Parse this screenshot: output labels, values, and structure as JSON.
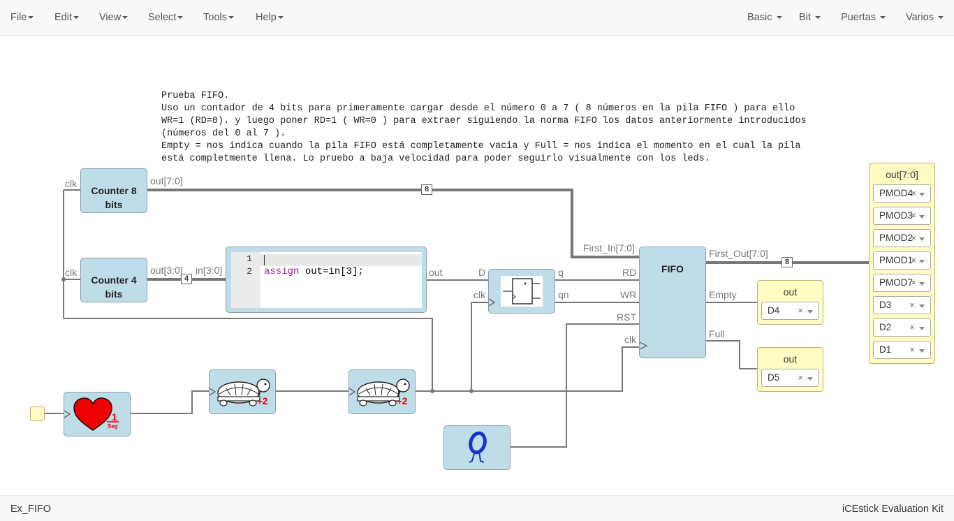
{
  "menu": {
    "file": "File",
    "edit": "Edit",
    "view": "View",
    "select": "Select",
    "tools": "Tools",
    "help": "Help",
    "basic": "Basic",
    "bit": "Bit",
    "puertas": "Puertas",
    "varios": "Varios"
  },
  "footer": {
    "project_name": "Ex_FIFO",
    "board": "iCEstick Evaluation Kit"
  },
  "comment": "Prueba FIFO.\nUso un contador de 4 bits para primeramente cargar desde el número 0 a 7 ( 8 números en la pila FIFO ) para ello\nWR=1 (RD=0). y luego poner RD=1 ( WR=0 ) para extraer siguiendo la norma FIFO los datos anteriormente introducidos\n(números del 0 al 7 ).\nEmpty = nos indica cuando la pila FIFO está completamente vacia y Full = nos indica el momento en el cual la pila\nestá completmente llena. Lo pruebo a baja velocidad para poder seguirlo visualmente con los leds.",
  "counter8": {
    "line1": "Counter 8",
    "line2": "bits",
    "in_port": "clk",
    "out_port": "out[7:0]",
    "bus_width": "8"
  },
  "counter4": {
    "line1": "Counter 4",
    "line2": "bits",
    "in_port": "clk",
    "out_port": "out[3:0]",
    "bus_width": "4"
  },
  "code_block": {
    "in_port": "in[3:0]",
    "out_port": "out",
    "line_numbers": [
      "1",
      "2"
    ],
    "code_keyword": "assign",
    "code_rest": " out=in[3];"
  },
  "flipflop": {
    "in_d": "D",
    "in_clk": "clk",
    "out_q": "q",
    "out_qn": "qn"
  },
  "fifo": {
    "title": "FIFO",
    "in_first": "First_In[7:0]",
    "in_rd": "RD",
    "in_wr": "WR",
    "in_rst": "RST",
    "in_clk": "clk",
    "out_first": "First_Out[7:0]",
    "out_empty": "Empty",
    "out_full": "Full",
    "bus_width": "8"
  },
  "out_empty": {
    "title": "out",
    "pin": "D4",
    "clear": "×"
  },
  "out_full": {
    "title": "out",
    "pin": "D5",
    "clear": "×"
  },
  "out_bus": {
    "title": "out[7:0]",
    "pins": [
      "PMOD4",
      "PMOD3",
      "PMOD2",
      "PMOD1",
      "PMOD7",
      "D3",
      "D2",
      "D1"
    ],
    "clear": "×"
  },
  "heart_block": {
    "label_num": "1",
    "label_den": "Seg"
  },
  "divider1": {
    "label": "÷2"
  },
  "divider2": {
    "label": "÷2"
  },
  "colors": {
    "block_fill": "#bfdde9",
    "output_fill": "#fffcc3",
    "wire": "#777777",
    "heart": "#ee0000",
    "ring": "#1733c9"
  }
}
